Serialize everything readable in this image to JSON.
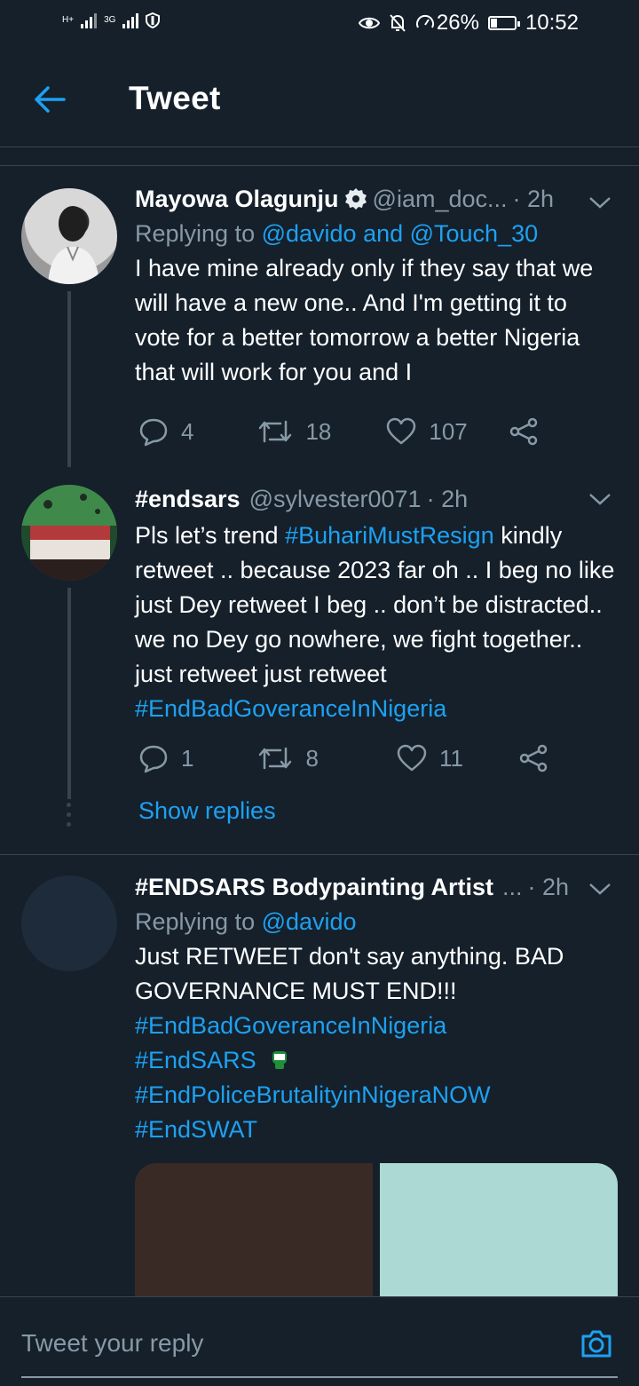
{
  "status_bar": {
    "net1_label": "H+",
    "net2_label": "3G",
    "battery_pct": "26%",
    "time": "10:52",
    "icons": [
      "signal-icon",
      "shield-icon",
      "eye-icon",
      "mute-icon",
      "speed-icon",
      "battery-icon"
    ]
  },
  "header": {
    "title": "Tweet",
    "back_icon": "arrow-left-icon"
  },
  "colors": {
    "background": "#15202b",
    "accent": "#1da1f2",
    "muted": "#8899a6",
    "divider": "#38444d"
  },
  "tweets": [
    {
      "name": "Mayowa Olagunju",
      "verified_icon": "badge-icon",
      "handle": "@iam_doc...",
      "time": "· 2h",
      "reply_prefix": "Replying to ",
      "reply_targets": "@davido and @Touch_30",
      "text": "I have mine already only if they say that we will have a new one..  And I'm getting it to vote for a better tomorrow a better Nigeria that will work for you and I",
      "replies": "4",
      "retweets": "18",
      "likes": "107"
    },
    {
      "name": "#endsars",
      "handle": "@sylvester0071",
      "time": "· 2h",
      "text_pre": "Pls let’s trend ",
      "text_tag1": "#BuhariMustResign",
      "text_mid": "  kindly retweet .. because 2023 far oh .. I beg no like just Dey retweet I beg .. don’t be distracted.. we no Dey go nowhere, we fight together.. just retweet just retweet ",
      "text_tag2": "#EndBadGoveranceInNigeria",
      "replies": "1",
      "retweets": "8",
      "likes": "11"
    },
    {
      "name": "#ENDSARS Bodypainting Artist",
      "handle_ellipsis": "...",
      "time": "· 2h",
      "reply_prefix": "Replying to ",
      "reply_targets": "@davido",
      "text": "Just RETWEET  don't say anything. BAD GOVERNANCE MUST END!!!",
      "tags": [
        "#EndBadGoveranceInNigeria",
        "#EndSARS",
        "#EndPoliceBrutalityinNigeraNOW",
        "#EndSWAT"
      ],
      "emoji": "fist-emoji"
    }
  ],
  "show_replies": "Show replies",
  "reply_bar": {
    "placeholder": "Tweet your reply",
    "icon": "camera-icon"
  }
}
